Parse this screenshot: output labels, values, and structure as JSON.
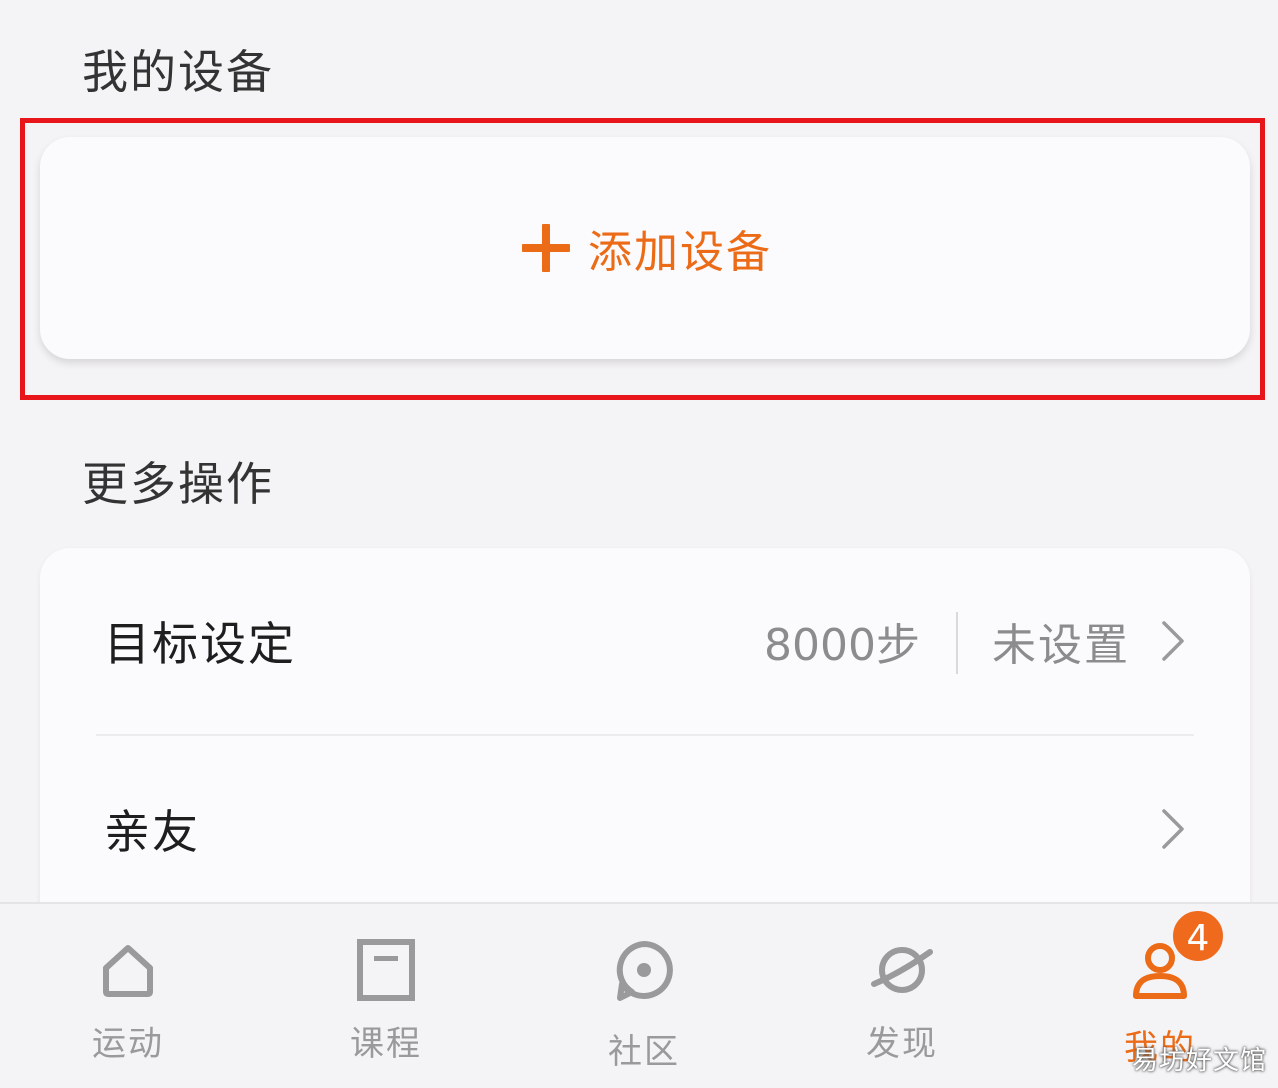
{
  "sections": {
    "devices_title": "我的设备",
    "more_title": "更多操作"
  },
  "add_device": {
    "label": "添加设备",
    "icon": "plus-icon",
    "accent_color": "#ec6b17"
  },
  "highlight_color": "#e8161b",
  "more_actions": [
    {
      "label": "目标设定",
      "steps": "8000步",
      "status": "未设置",
      "icon": "chevron-right-icon"
    },
    {
      "label": "亲友",
      "icon": "chevron-right-icon"
    }
  ],
  "tabbar": {
    "tabs": [
      {
        "label": "运动",
        "icon": "home-icon",
        "active": false
      },
      {
        "label": "课程",
        "icon": "course-icon",
        "active": false
      },
      {
        "label": "社区",
        "icon": "community-icon",
        "active": false
      },
      {
        "label": "发现",
        "icon": "planet-icon",
        "active": false
      },
      {
        "label": "我的",
        "icon": "person-icon",
        "active": true
      }
    ],
    "badge": "4"
  },
  "watermark": "易坊好文馆"
}
